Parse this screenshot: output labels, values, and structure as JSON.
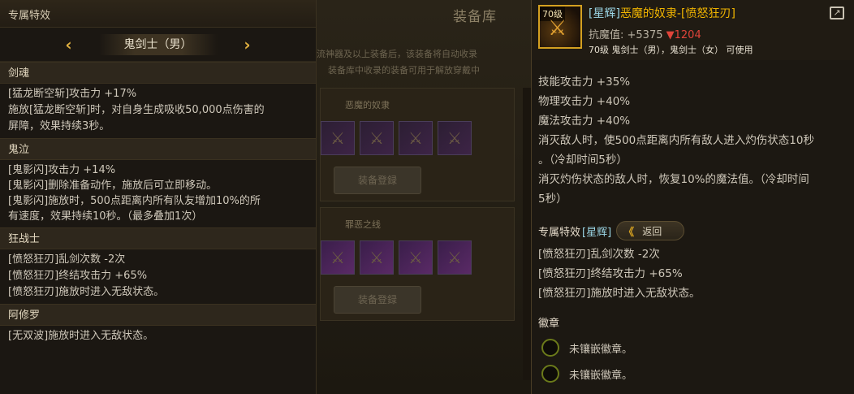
{
  "background": {
    "title": "装备库",
    "notice_line1": "流神器及以上装备后，该装备将自动收录",
    "notice_line2": "装备库中收录的装备可用于解放穿戴中",
    "group1_label": "恶魔的奴隶",
    "group2_label": "罪恶之线",
    "button_label": "装备登録"
  },
  "left_panel": {
    "header": "专属特效",
    "class_selector": {
      "prev_arrow": "‹",
      "current": "鬼剑士（男）",
      "next_arrow": "›"
    },
    "sections": [
      {
        "title": "剑魂",
        "lines": [
          "[猛龙断空斩]攻击力 +17%",
          "施放[猛龙断空斩]时，对自身生成吸收50,000点伤害的",
          "屏障，效果持续3秒。"
        ]
      },
      {
        "title": "鬼泣",
        "lines": [
          "[鬼影闪]攻击力 +14%",
          "[鬼影闪]删除准备动作，施放后可立即移动。",
          "[鬼影闪]施放时，500点距离内所有队友增加10%的所",
          "有速度，效果持续10秒。（最多叠加1次）"
        ]
      },
      {
        "title": "狂战士",
        "lines": [
          "[愤怒狂刃]乱剑次数 -2次",
          "[愤怒狂刃]终结攻击力 +65%",
          "[愤怒狂刃]施放时进入无敌状态。"
        ]
      },
      {
        "title": "阿修罗",
        "lines": [
          "[无双波]施放时进入无敌状态。"
        ]
      }
    ]
  },
  "item_panel": {
    "level_badge": "70级",
    "name_tag": "[星辉]",
    "name": "恶魔的奴隶-[愤怒狂刃]",
    "resist_label": "抗魔值: +5375",
    "resist_change": "▼1204",
    "usable": "70级 鬼剑士（男），鬼剑士（女） 可使用",
    "stats": [
      "技能攻击力 +35%",
      "物理攻击力 +40%",
      "魔法攻击力 +40%",
      "消灭敌人时，使500点距离内所有敌人进入灼伤状态10秒",
      "。（冷却时间5秒）",
      "消灭灼伤状态的敌人时，恢复10%的魔法值。（冷却时间",
      "5秒）"
    ],
    "exclusive_label": "专属特效",
    "exclusive_tag": "[星辉]",
    "back_button": "返回",
    "back_chevron": "《",
    "exclusive_lines": [
      "[愤怒狂刃]乱剑次数 -2次",
      "[愤怒狂刃]终结攻击力 +65%",
      "[愤怒狂刃]施放时进入无敌状态。"
    ],
    "emblem_title": "徽章",
    "emblem_slots": [
      "未镶嵌徽章。",
      "未镶嵌徽章。"
    ]
  },
  "colors": {
    "item_name": "#f0b400",
    "tag": "#9bd6e6",
    "decrease": "#e0443a",
    "arrow": "#e0b040"
  }
}
